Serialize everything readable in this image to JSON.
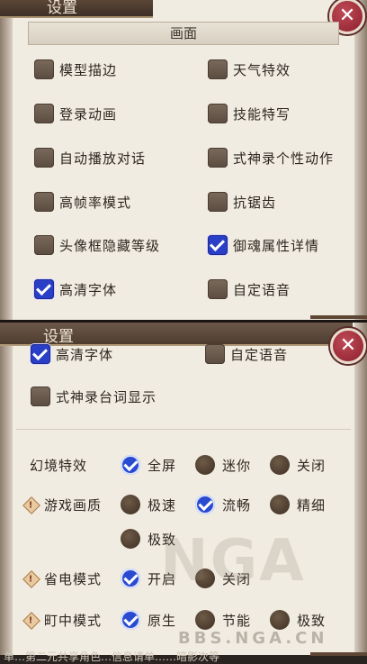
{
  "panel1": {
    "title": "设置",
    "section": "画面",
    "close_glyph": "✕",
    "options": [
      {
        "label": "模型描边",
        "checked": false
      },
      {
        "label": "天气特效",
        "checked": false
      },
      {
        "label": "登录动画",
        "checked": false
      },
      {
        "label": "技能特写",
        "checked": false
      },
      {
        "label": "自动播放对话",
        "checked": false
      },
      {
        "label": "式神录个性动作",
        "checked": false
      },
      {
        "label": "高帧率模式",
        "checked": false
      },
      {
        "label": "抗锯齿",
        "checked": false
      },
      {
        "label": "头像框隐藏等级",
        "checked": false
      },
      {
        "label": "御魂属性详情",
        "checked": true
      },
      {
        "label": "高清字体",
        "checked": true
      },
      {
        "label": "自定语音",
        "checked": false
      }
    ]
  },
  "panel2": {
    "title": "设置",
    "close_glyph": "✕",
    "options": [
      {
        "label": "高清字体",
        "checked": true
      },
      {
        "label": "自定语音",
        "checked": false
      },
      {
        "label": "式神录台词显示",
        "checked": false
      }
    ],
    "rows": [
      {
        "label": "幻境特效",
        "warn": false,
        "choices": [
          {
            "label": "全屏",
            "selected": true
          },
          {
            "label": "迷你",
            "selected": false
          },
          {
            "label": "关闭",
            "selected": false
          }
        ]
      },
      {
        "label": "游戏画质",
        "warn": true,
        "choices": [
          {
            "label": "极速",
            "selected": false
          },
          {
            "label": "流畅",
            "selected": true
          },
          {
            "label": "精细",
            "selected": false
          },
          {
            "label": "极致",
            "selected": false
          }
        ]
      },
      {
        "label": "省电模式",
        "warn": true,
        "choices": [
          {
            "label": "开启",
            "selected": true
          },
          {
            "label": "关闭",
            "selected": false
          }
        ]
      },
      {
        "label": "町中模式",
        "warn": true,
        "choices": [
          {
            "label": "原生",
            "selected": true
          },
          {
            "label": "节能",
            "selected": false
          },
          {
            "label": "极致",
            "selected": false
          }
        ]
      }
    ],
    "warn_glyph": "!",
    "footer_text": "单…第二元共享角色…信息请单……暗影次等"
  },
  "watermark": {
    "logo": "NGA",
    "url": "BBS.NGA.CN"
  },
  "colors": {
    "checked": "#2a3fc7",
    "close": "#a82d3b"
  }
}
